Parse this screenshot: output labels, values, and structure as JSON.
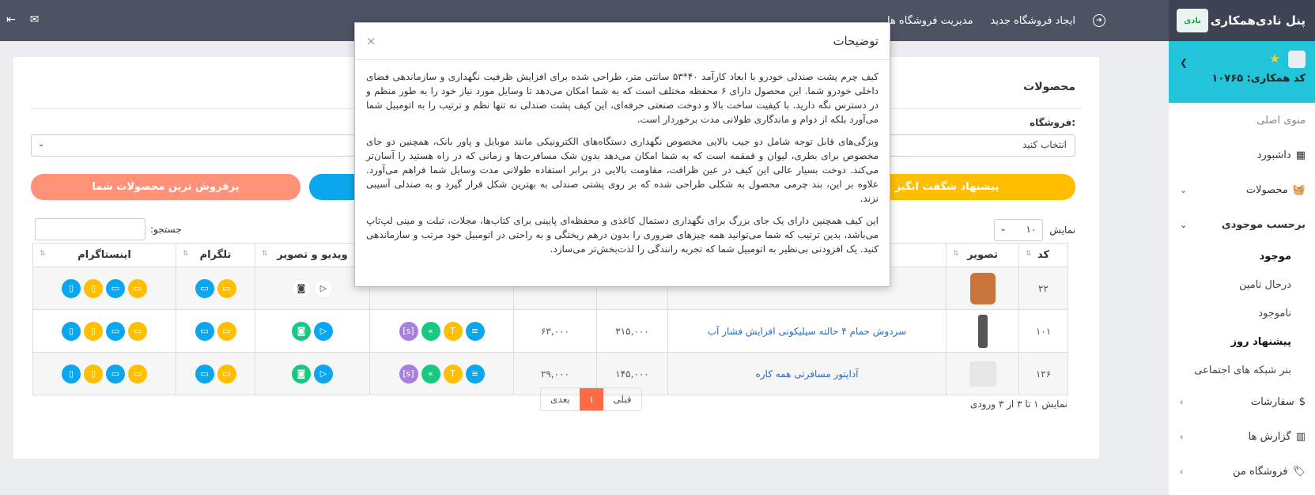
{
  "topbar": {
    "nav_manage": "مدیریت فروشگاه ها",
    "nav_create": "ایجاد فروشگاه جدید",
    "icons": [
      "exit-icon",
      "mail-icon"
    ]
  },
  "sidebar": {
    "title": "پنل نادی‌همکاری",
    "logo_text": "نادی",
    "user_code": "کد همکاری: ۱۰۷۶۵",
    "main_menu": "منوی اصلی",
    "dashboard": "داشبورد",
    "products": "محصولات",
    "stock_tag": "برحسب موجودی",
    "sub_items": [
      "موجود",
      "درحال تامین",
      "ناموجود",
      "پیشنهاد روز",
      "بنر شبکه های اجتماعی"
    ],
    "orders": "سفارشات",
    "reports": "گزارش ها",
    "my_store": "فروشگاه من"
  },
  "main": {
    "card_title": "محصولات",
    "store_label": "فروشگاه:",
    "store_select": "انتخاب کنید",
    "btn_amazing": "پیشنهاد شگفت انگیز",
    "btn_best": "پرفروش ترین محصولات شما",
    "show_label": "نمایش",
    "show_value": "۱۰",
    "search_label": "جستجو:",
    "columns": [
      "کد",
      "تصویر",
      "",
      "",
      "",
      "",
      "ویدیو و تصویر",
      "تلگرام",
      "اینستاگرام"
    ],
    "rows": [
      {
        "code": "۲۲",
        "name": "",
        "price": "",
        "commission": ""
      },
      {
        "code": "۱۰۱",
        "name": "سردوش حمام ۴ حالته سیلیکونی افزایش فشار آب",
        "price": "۳۱۵,۰۰۰",
        "commission": "۶۳,۰۰۰"
      },
      {
        "code": "۱۲۶",
        "name": "آداپتور مسافرتی همه کاره",
        "price": "۱۴۵,۰۰۰",
        "commission": "۲۹,۰۰۰"
      }
    ],
    "footer_info": "نمایش ۱ تا ۳ از ۳ ورودی",
    "pager_prev": "قبلی",
    "pager_current": "۱",
    "pager_next": "بعدی"
  },
  "modal": {
    "title": "توضیحات",
    "close": "×",
    "p1": "کیف چرم پشت صندلی خودرو با ابعاد کارآمد ۴۰*۵۳ سانتی متر، طراحی شده برای افزایش ظرفیت نگهداری و سازماندهی فضای داخلی خودرو شما. این محصول دارای ۶ محفظه مختلف است که به شما امکان می‌دهد تا وسایل مورد نیاز خود را به طور منظم و در دسترس نگه دارید. با کیفیت ساخت بالا و دوخت صنعتی حرفه‌ای، این کیف پشت صندلی نه تنها نظم و ترتیب را به اتومبیل شما می‌آورد بلکه از دوام و ماندگاری طولانی مدت برخوردار است.",
    "p2": "ویژگی‌های قابل توجه شامل دو جیب بالایی مخصوص نگهداری دستگاه‌های الکترونیکی مانند موبایل و پاور بانک، همچنین دو جای مخصوص برای بطری، لیوان و قمقمه است که به شما امکان می‌دهد بدون شک مسافرت‌ها و زمانی که در راه هستید را آسان‌تر می‌کند. دوخت بسیار عالی این کیف در عین ظرافت، مقاومت بالایی در برابر استفاده طولانی مدت وسایل شما فراهم می‌آورد. علاوه بر این، بند چرمی محصول به شکلی طراحی شده که بر روی پشتی صندلی به بهترین شکل قرار گیرد و به صندلی آسیبی نزند.",
    "p3": "این کیف همچنین دارای یک جای بزرگ برای نگهداری دستمال کاغذی و محفظه‌ای پایینی برای کتاب‌ها، مجلات، تبلت و مینی لپ‌تاپ می‌باشد، بدین ترتیب که شما می‌توانید همه چیزهای ضروری را بدون درهم ریختگی و به راحتی در اتومبیل خود مرتب و سازماندهی کنید. یک افزودنی بی‌نظیر به اتومبیل شما که تجربه رانندگی را لذت‌بخش‌تر می‌سازد."
  }
}
